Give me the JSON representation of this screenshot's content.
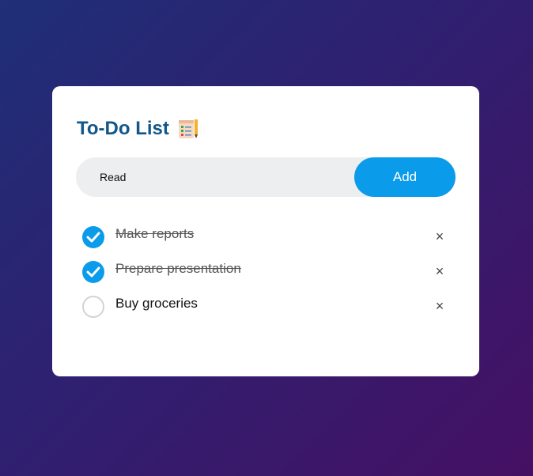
{
  "app": {
    "title": "To-Do List",
    "title_icon": "notepad-checklist-icon"
  },
  "input": {
    "value": "Read",
    "add_label": "Add"
  },
  "tasks": [
    {
      "text": "Make reports",
      "done": true,
      "delete_label": "×"
    },
    {
      "text": "Prepare presentation",
      "done": true,
      "delete_label": "×"
    },
    {
      "text": "Buy groceries",
      "done": false,
      "delete_label": "×"
    }
  ],
  "colors": {
    "accent": "#0a9bea",
    "title": "#12578a",
    "background_start": "#1f2f78",
    "background_end": "#451064"
  }
}
